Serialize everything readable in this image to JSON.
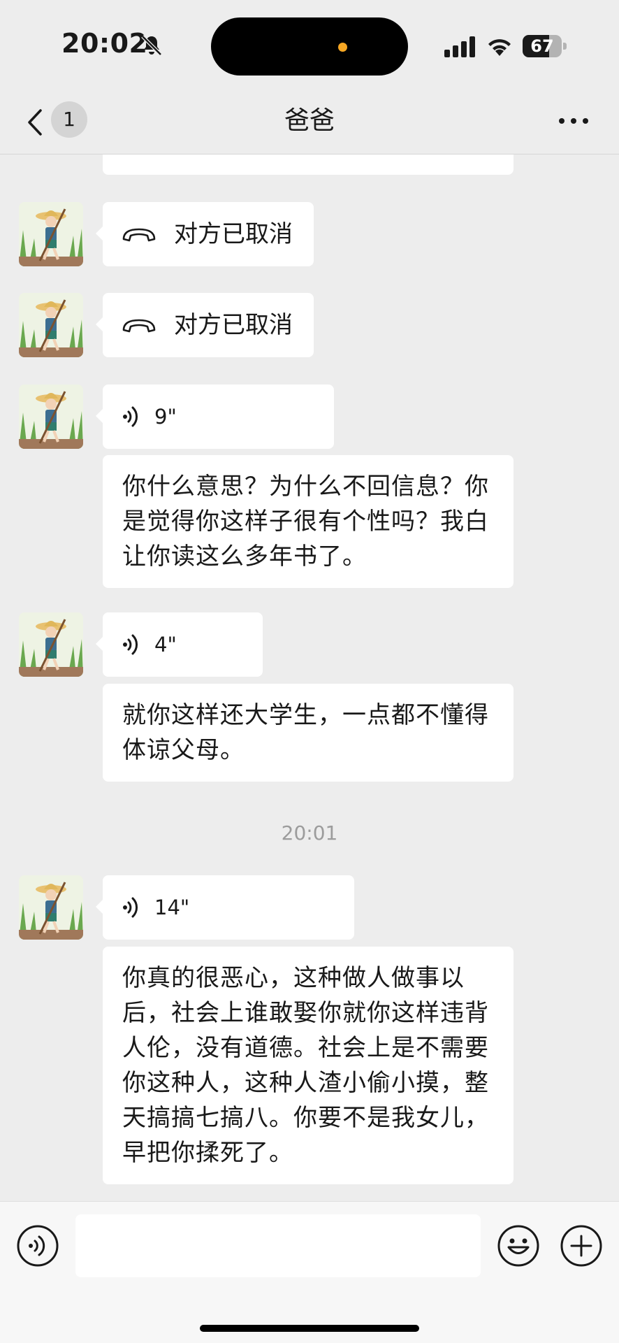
{
  "status_bar": {
    "time": "20:02",
    "battery": "67",
    "battery_level": 0.67
  },
  "nav": {
    "title": "爸爸",
    "unread_count": "1"
  },
  "messages": {
    "call_1": "对方已取消",
    "call_2": "对方已取消",
    "voice_1": "9\"",
    "text_1": "你什么意思？为什么不回信息？你是觉得你这样子很有个性吗？我白让你读这么多年书了。",
    "voice_2": "4\"",
    "text_2": "就你这样还大学生，一点都不懂得体谅父母。",
    "timestamp": "20:01",
    "voice_3": "14\"",
    "text_3": "你真的很恶心，这种做人做事以后，社会上谁敢娶你就你这样违背人伦，没有道德。社会上是不需要你这种人，这种人渣小偷小摸，整天搞搞七搞八。你要不是我女儿，早把你揉死了。"
  },
  "input": {
    "value": "",
    "placeholder": ""
  },
  "icons": {
    "back": "chevron-left-icon",
    "more": "ellipsis-icon",
    "call": "phone-hangup-icon",
    "voice": "voice-wave-icon",
    "emoji": "smiley-icon",
    "plus": "plus-circle-icon"
  }
}
